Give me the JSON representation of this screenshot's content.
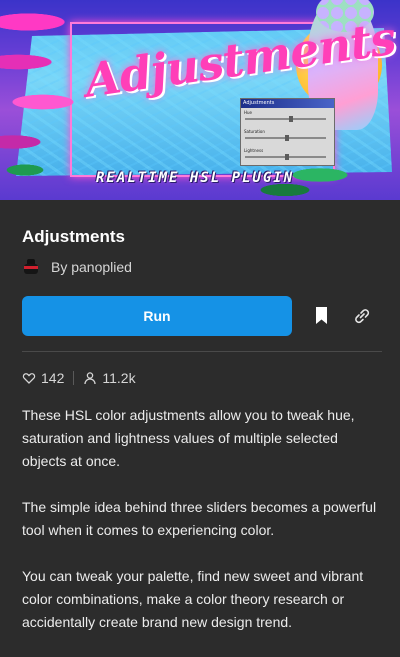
{
  "hero": {
    "title": "Adjustments",
    "subtitle": "REALTIME HSL PLUGIN",
    "mini_window": {
      "title": "Adjustments",
      "sliders": [
        {
          "label": "Hue",
          "level": 0.55
        },
        {
          "label": "Saturation",
          "level": 0.5
        },
        {
          "label": "Lightness",
          "level": 0.5
        }
      ]
    }
  },
  "plugin": {
    "title": "Adjustments",
    "author": "By panoplied"
  },
  "actions": {
    "run_label": "Run",
    "bookmark_icon": "bookmark-icon",
    "link_icon": "link-icon"
  },
  "stats": {
    "likes": "142",
    "users": "11.2k"
  },
  "description": [
    "These HSL color adjustments allow you to tweak hue, saturation and lightness values of multiple selected objects at once.",
    "The simple idea behind three sliders becomes a powerful tool when it comes to experiencing color.",
    "You can tweak your palette, find new sweet and vibrant color combinations, make a color theory research or accidentally create brand new design trend."
  ],
  "colors": {
    "background": "#2c2c2c",
    "run_button": "#1592e6",
    "text_primary": "#ffffff",
    "text_secondary": "#d6d6d6"
  }
}
